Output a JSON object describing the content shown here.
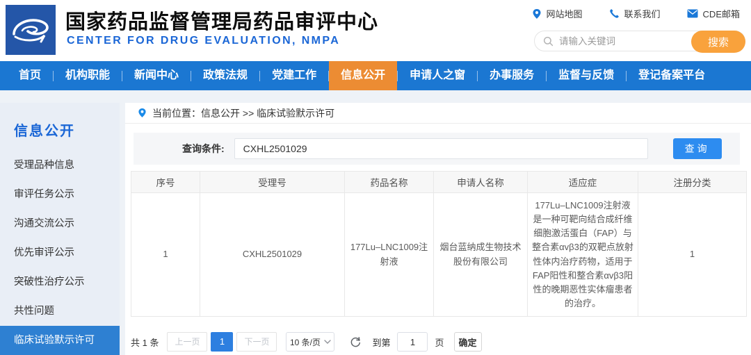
{
  "header": {
    "title": "国家药品监督管理局药品审评中心",
    "subtitle": "CENTER FOR DRUG EVALUATION, NMPA",
    "links": {
      "sitemap": "网站地图",
      "contact": "联系我们",
      "mailbox": "CDE邮箱"
    },
    "search": {
      "placeholder": "请输入关键词",
      "button": "搜索"
    }
  },
  "nav": {
    "items": [
      "首页",
      "机构职能",
      "新闻中心",
      "政策法规",
      "党建工作",
      "信息公开",
      "申请人之窗",
      "办事服务",
      "监督与反馈",
      "登记备案平台"
    ],
    "active": "信息公开"
  },
  "sidebar": {
    "title": "信息公开",
    "items": [
      "受理品种信息",
      "审评任务公示",
      "沟通交流公示",
      "优先审评公示",
      "突破性治疗公示",
      "共性问题",
      "临床试验默示许可"
    ],
    "active": "临床试验默示许可"
  },
  "main": {
    "breadcrumb": "当前位置：信息公开 >> 临床试验默示许可",
    "query": {
      "label": "查询条件:",
      "value": "CXHL2501029",
      "button": "查询"
    },
    "table": {
      "headers": [
        "序号",
        "受理号",
        "药品名称",
        "申请人名称",
        "适应症",
        "注册分类"
      ],
      "rows": [
        [
          "1",
          "CXHL2501029",
          "177Lu–LNC1009注射液",
          "烟台蓝纳成生物技术股份有限公司",
          "177Lu–LNC1009注射液是一种可靶向结合成纤维细胞激活蛋白（FAP）与整合素αvβ3的双靶点放射性体内治疗药物，适用于FAP阳性和整合素αvβ3阳性的晚期恶性实体瘤患者的治疗。",
          "1"
        ]
      ]
    },
    "pagination": {
      "total": "共 1 条",
      "prev": "上一页",
      "page": "1",
      "next": "下一页",
      "page_size": "10 条/页",
      "goto_label": "到第",
      "goto_value": "1",
      "unit": "页",
      "confirm": "确定"
    }
  },
  "colors": {
    "nav_blue": "#1b77d2",
    "nav_active_orange": "#ec8c33",
    "search_orange": "#f9a23c",
    "brand_blue": "#1a66d6",
    "query_button_blue": "#2d8cf0",
    "active_page_blue": "#2d7fe0",
    "sidebar_bg": "#e9eef6",
    "sidebar_active_blue": "#2e80d2",
    "logo_blue": "#2456a8"
  }
}
